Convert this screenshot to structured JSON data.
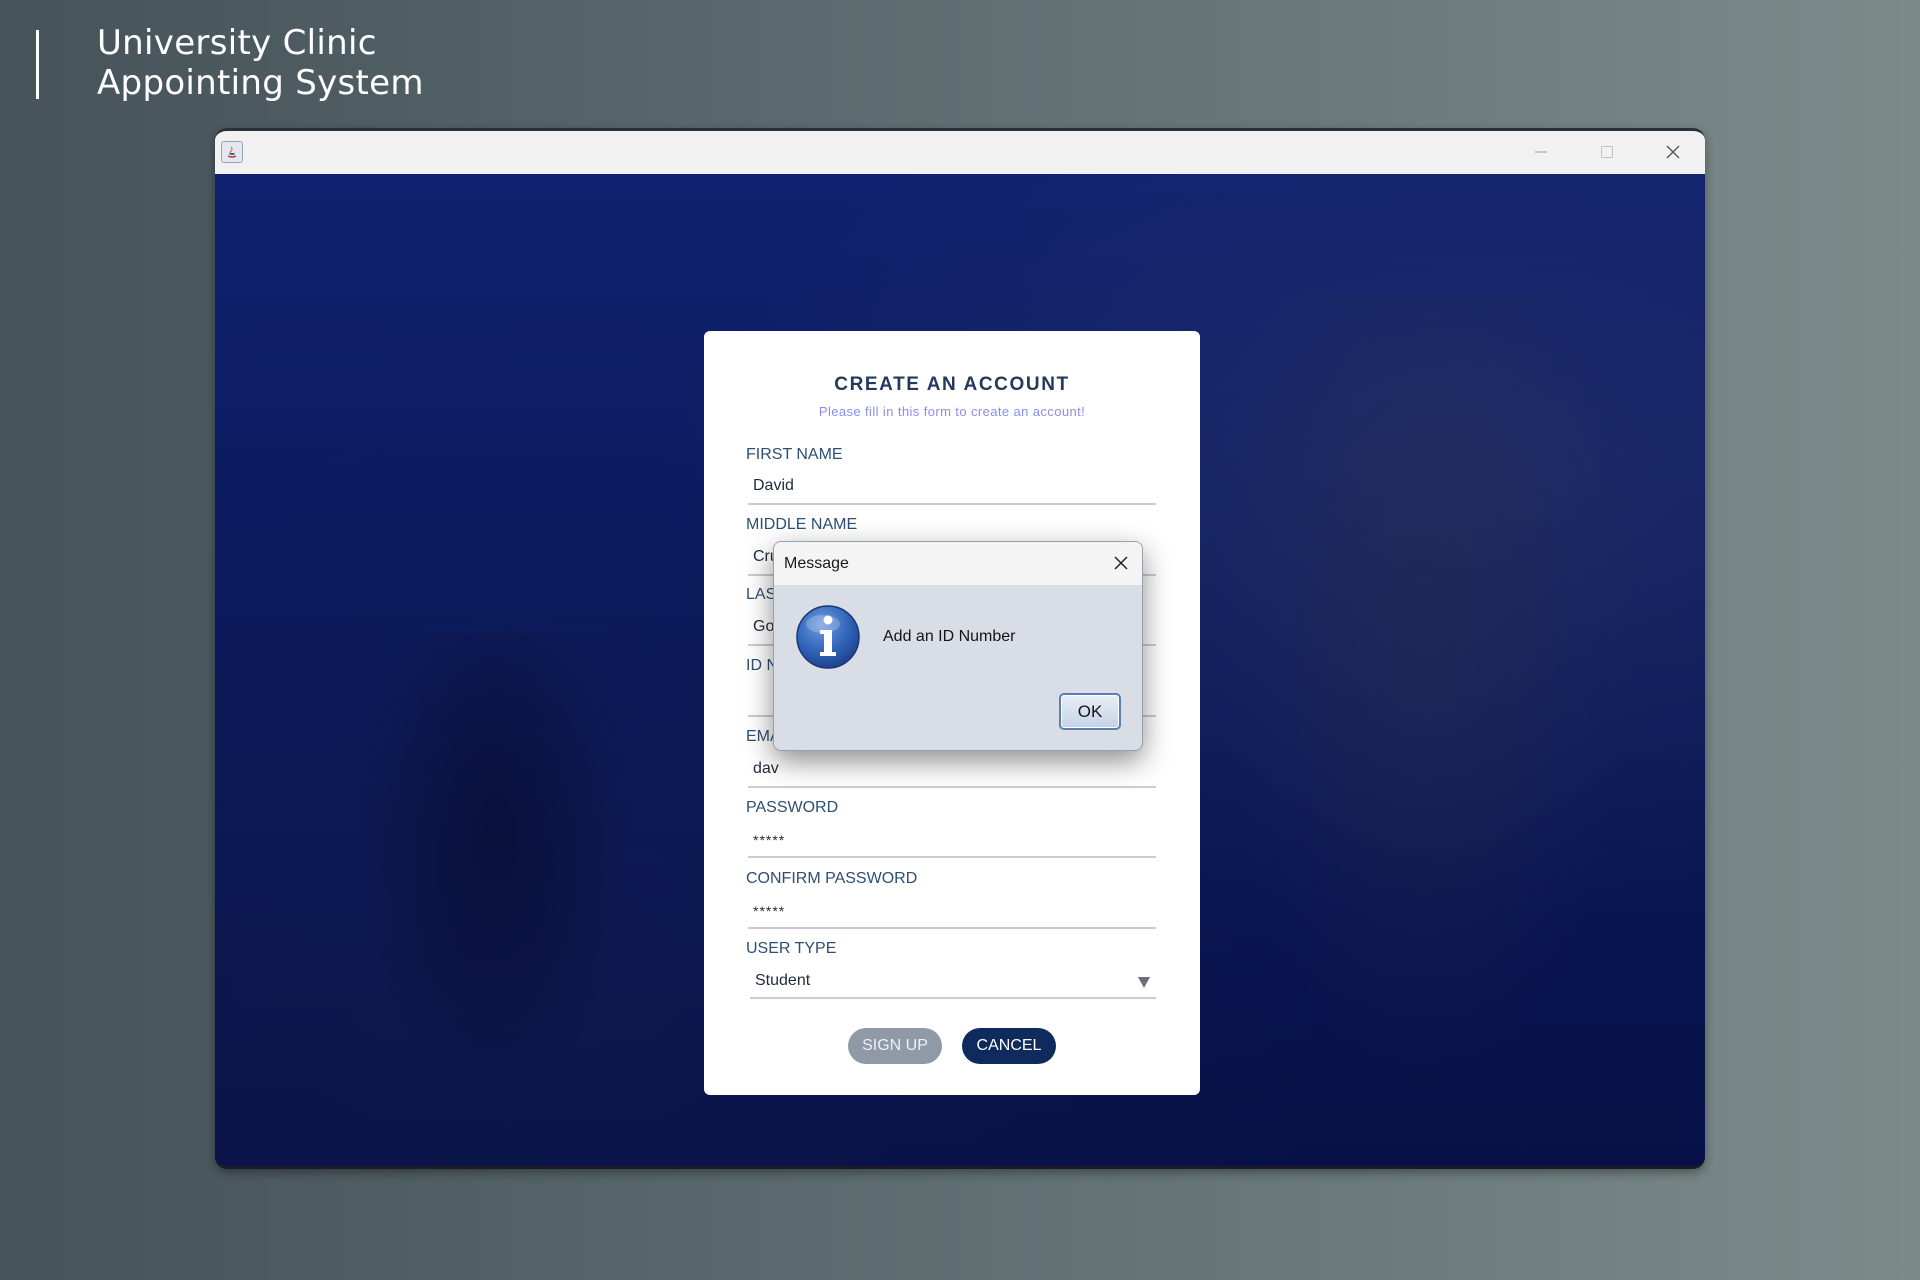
{
  "page": {
    "title_line1": "University Clinic",
    "title_line2": "Appointing System"
  },
  "window": {
    "icon": "java-app-icon",
    "controls": [
      "minimize-icon",
      "maximize-icon",
      "close-icon"
    ]
  },
  "form": {
    "title": "CREATE AN ACCOUNT",
    "subtitle": "Please fill in this form to create an account!",
    "fields": {
      "first_name": {
        "label": "FIRST NAME",
        "value": "David"
      },
      "middle_name": {
        "label": "MIDDLE NAME",
        "value": "Cruz"
      },
      "last_name": {
        "label": "LAS",
        "value": "Go"
      },
      "id_number": {
        "label": "ID N",
        "value": ""
      },
      "email": {
        "label": "EMA",
        "value": "dav"
      },
      "password": {
        "label": "PASSWORD",
        "value": "*****"
      },
      "confirm_password": {
        "label": "CONFIRM PASSWORD",
        "value": "*****"
      },
      "user_type": {
        "label": "USER TYPE",
        "value": "Student"
      }
    },
    "signup_label": "SIGN UP",
    "cancel_label": "CANCEL",
    "colors": {
      "signup_button": "#8f9aa6",
      "cancel_button": "#0f2a5c",
      "title": "#223a5e",
      "subtitle": "#8a8df0"
    }
  },
  "dialog": {
    "title": "Message",
    "message": "Add an ID Number",
    "ok_label": "OK",
    "icon": "info-icon"
  }
}
